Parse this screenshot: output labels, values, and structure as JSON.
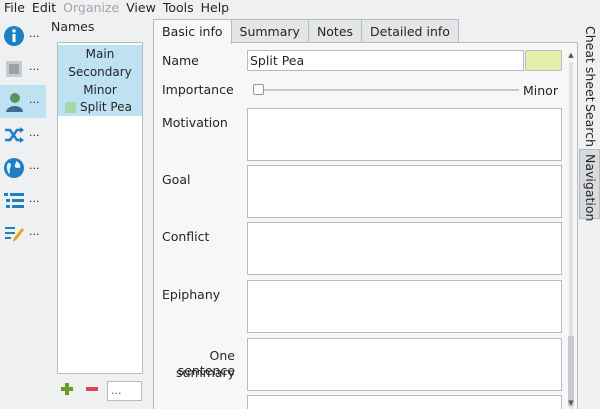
{
  "menu": [
    "File",
    "Edit",
    "Organize",
    "View",
    "Tools",
    "Help"
  ],
  "leftbar": {
    "items": [
      {
        "icon": "info-icon",
        "label": "..."
      },
      {
        "icon": "square-icon",
        "label": "..."
      },
      {
        "icon": "person-icon",
        "label": "...",
        "selected": true
      },
      {
        "icon": "shuffle-icon",
        "label": "..."
      },
      {
        "icon": "globe-icon",
        "label": "..."
      },
      {
        "icon": "list-icon",
        "label": "..."
      },
      {
        "icon": "edit-icon",
        "label": "..."
      }
    ]
  },
  "names": {
    "label": "Names",
    "groups": [
      "Main",
      "Secondary",
      "Minor"
    ],
    "character": {
      "name": "Split Pea",
      "color": "#a5d6a7"
    },
    "add_icon": "plus-icon",
    "remove_icon": "minus-icon",
    "filter_placeholder": "..."
  },
  "tabs": [
    "Basic info",
    "Summary",
    "Notes",
    "Detailed info"
  ],
  "form": {
    "name_label": "Name",
    "name_value": "Split Pea",
    "color_value": "#e6eeab",
    "importance_label": "Importance",
    "importance_end": "Minor",
    "importance_level": 0,
    "motivation_label": "Motivation",
    "goal_label": "Goal",
    "conflict_label": "Conflict",
    "epiphany_label": "Epiphany",
    "summary_label_1": "One sentence",
    "summary_label_2": "summary"
  },
  "right_tabs": [
    {
      "label": "Cheat sheet",
      "active": false
    },
    {
      "label": "Search",
      "active": false
    },
    {
      "label": "Navigation",
      "active": true
    }
  ],
  "colors": {
    "selection": "#bfe2f3",
    "accent": "#1d7fc4"
  }
}
